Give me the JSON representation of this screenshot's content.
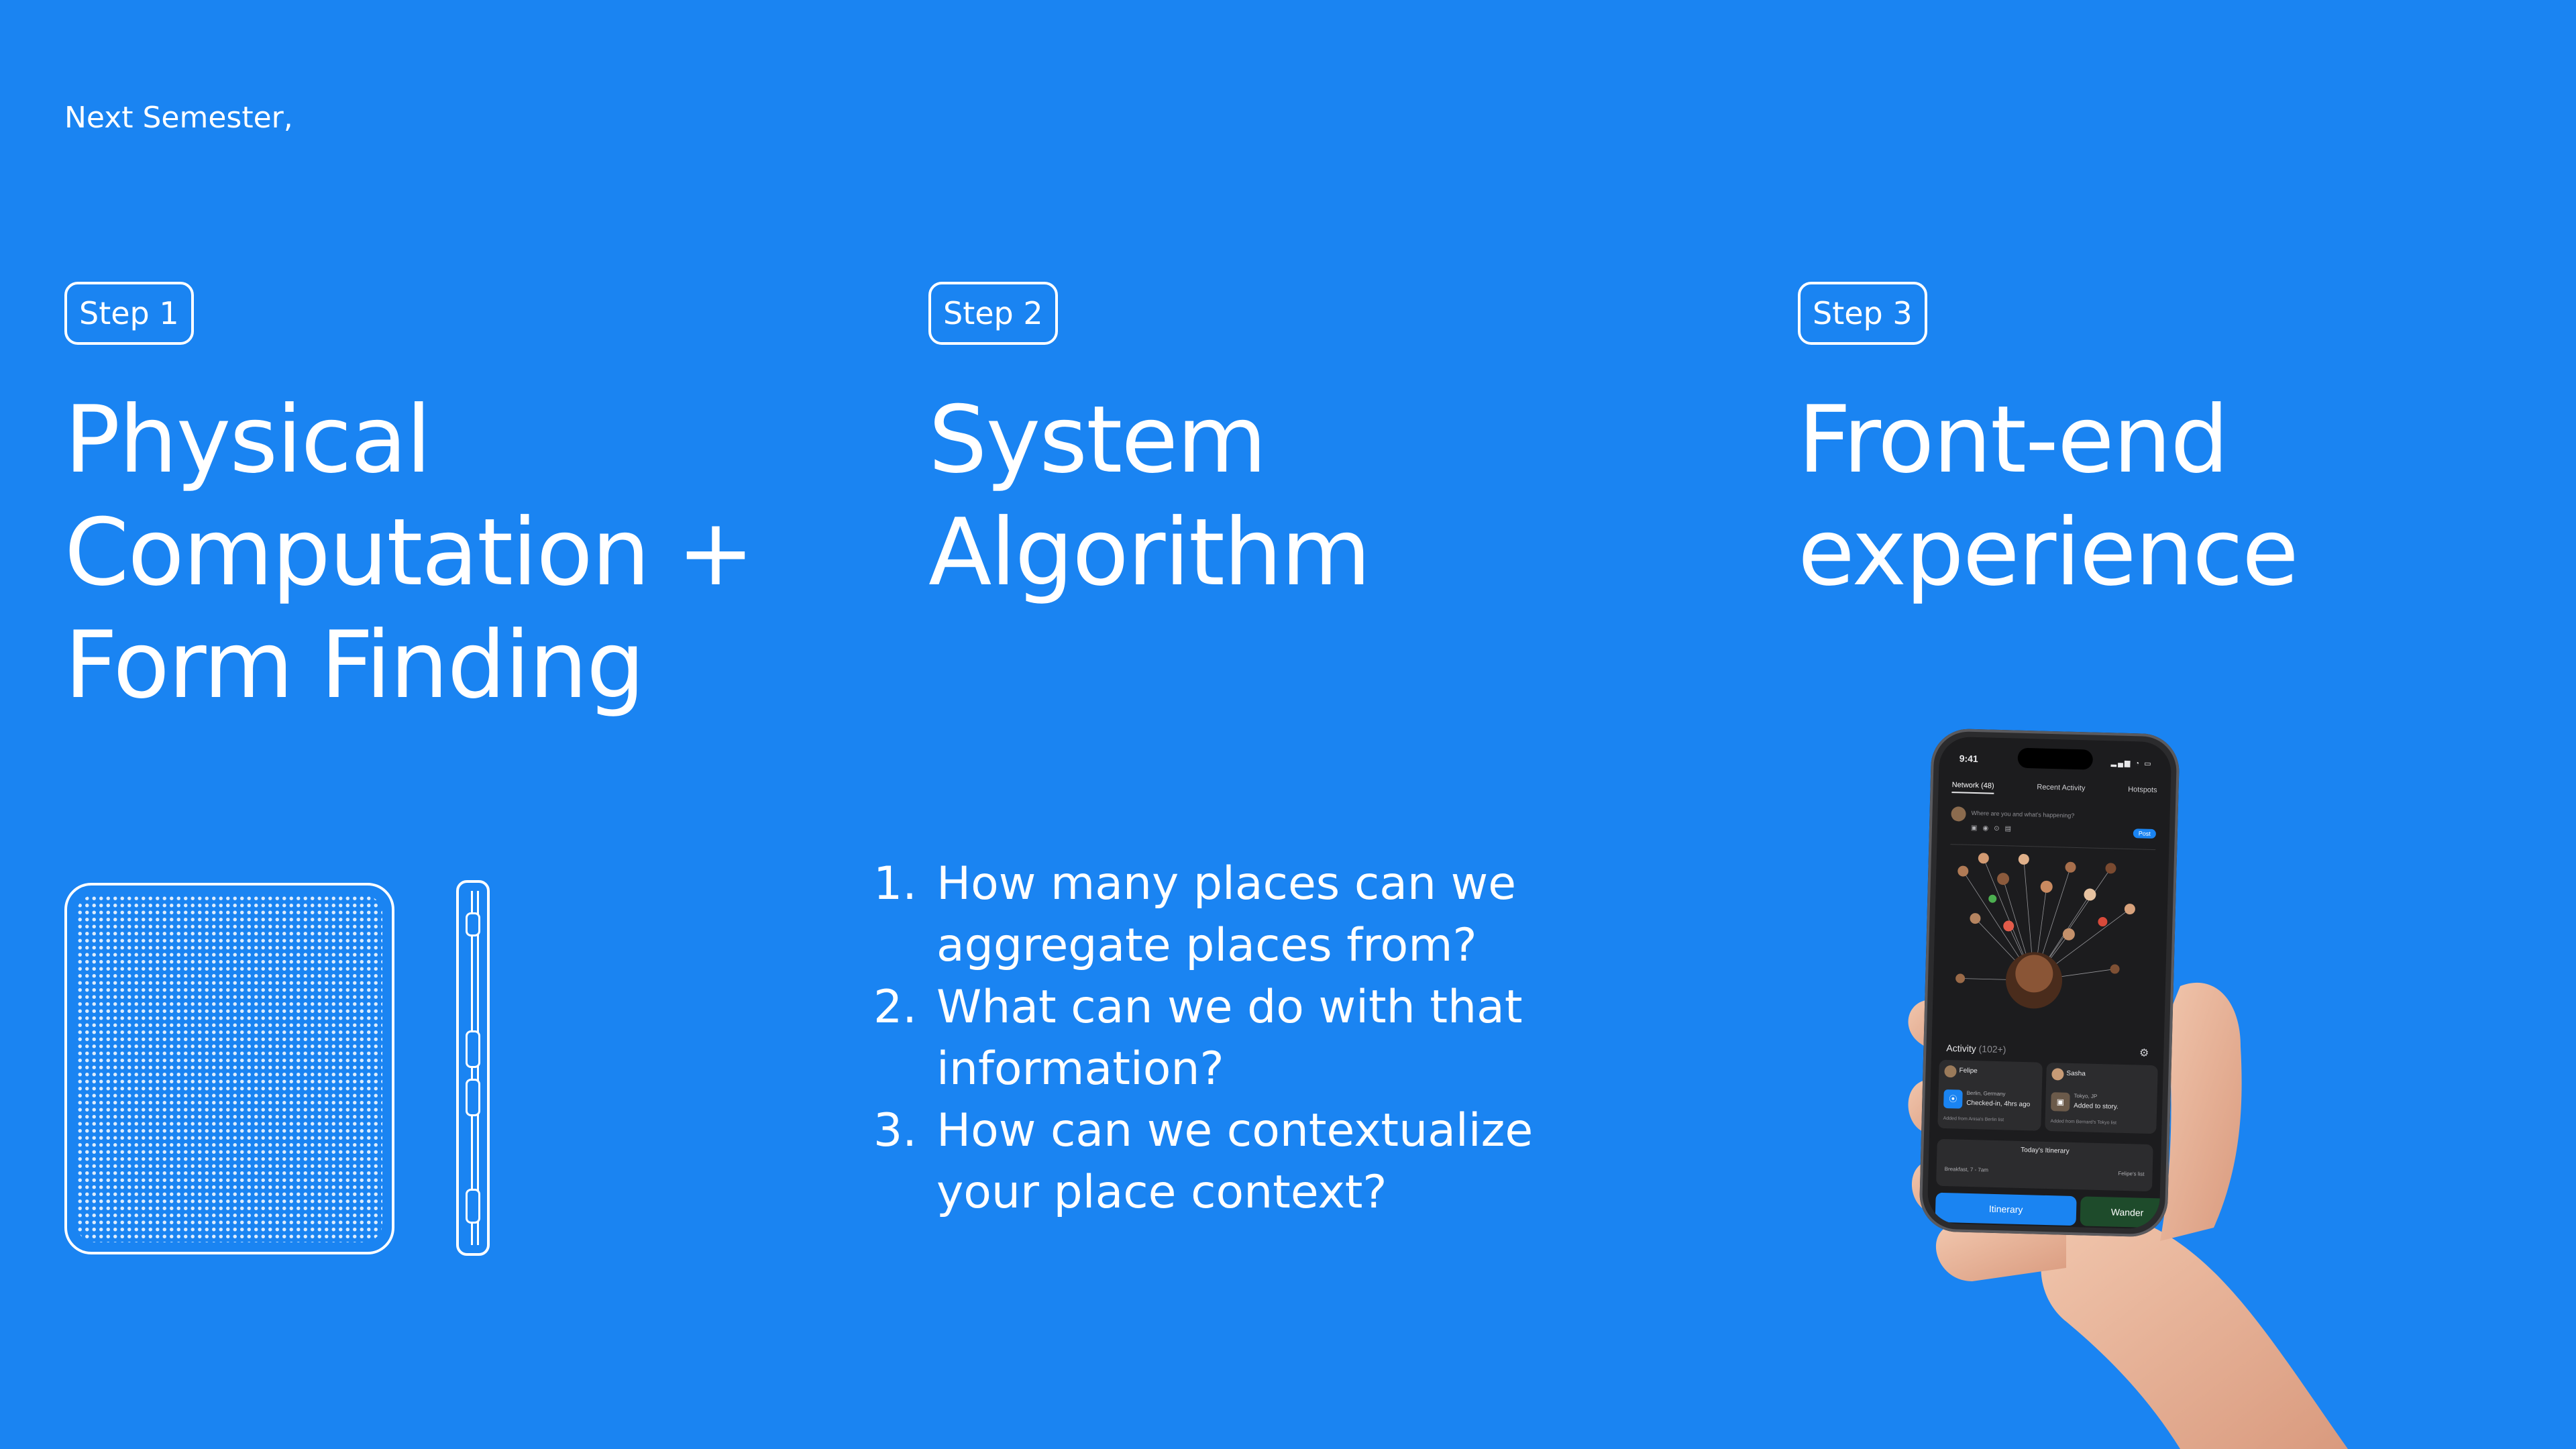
{
  "header": {
    "kicker": "Next Semester,"
  },
  "steps": [
    {
      "badge": "Step 1",
      "title": "Physical\nComputation +\nForm Finding"
    },
    {
      "badge": "Step 2",
      "title": "System\nAlgorithm"
    },
    {
      "badge": "Step 3",
      "title": "Front-end\nexperience"
    }
  ],
  "questions": [
    {
      "num": "1.",
      "text": "How many places can we aggregate places from?"
    },
    {
      "num": "2.",
      "text": "What can we do with that information?"
    },
    {
      "num": "3.",
      "text": "How can we contextualize your place context?"
    }
  ],
  "phone": {
    "status_time": "9:41",
    "tabs": [
      "Network (48)",
      "Recent Activity",
      "Hotspots"
    ],
    "compose_placeholder": "Where are you and what's happening?",
    "post_label": "Post",
    "activity_label": "Activity",
    "activity_count": "(102+)",
    "cards": [
      {
        "name": "Felipe",
        "line1": "Berlin, Germany",
        "line2": "Checked-in, 4hrs ago",
        "footer": "Added from Anisa's Berlin list"
      },
      {
        "name": "Sasha",
        "line1": "Tokyo, JP",
        "line2": "Added to story.",
        "footer": "Added from Bernard's Tokyo list"
      }
    ],
    "itinerary_title": "Today's Itinerary",
    "itinerary_row_left": "Breakfast, 7 - 7am",
    "itinerary_row_right": "Felipe's list",
    "btn_itinerary": "Itinerary",
    "btn_wander": "Wander"
  }
}
